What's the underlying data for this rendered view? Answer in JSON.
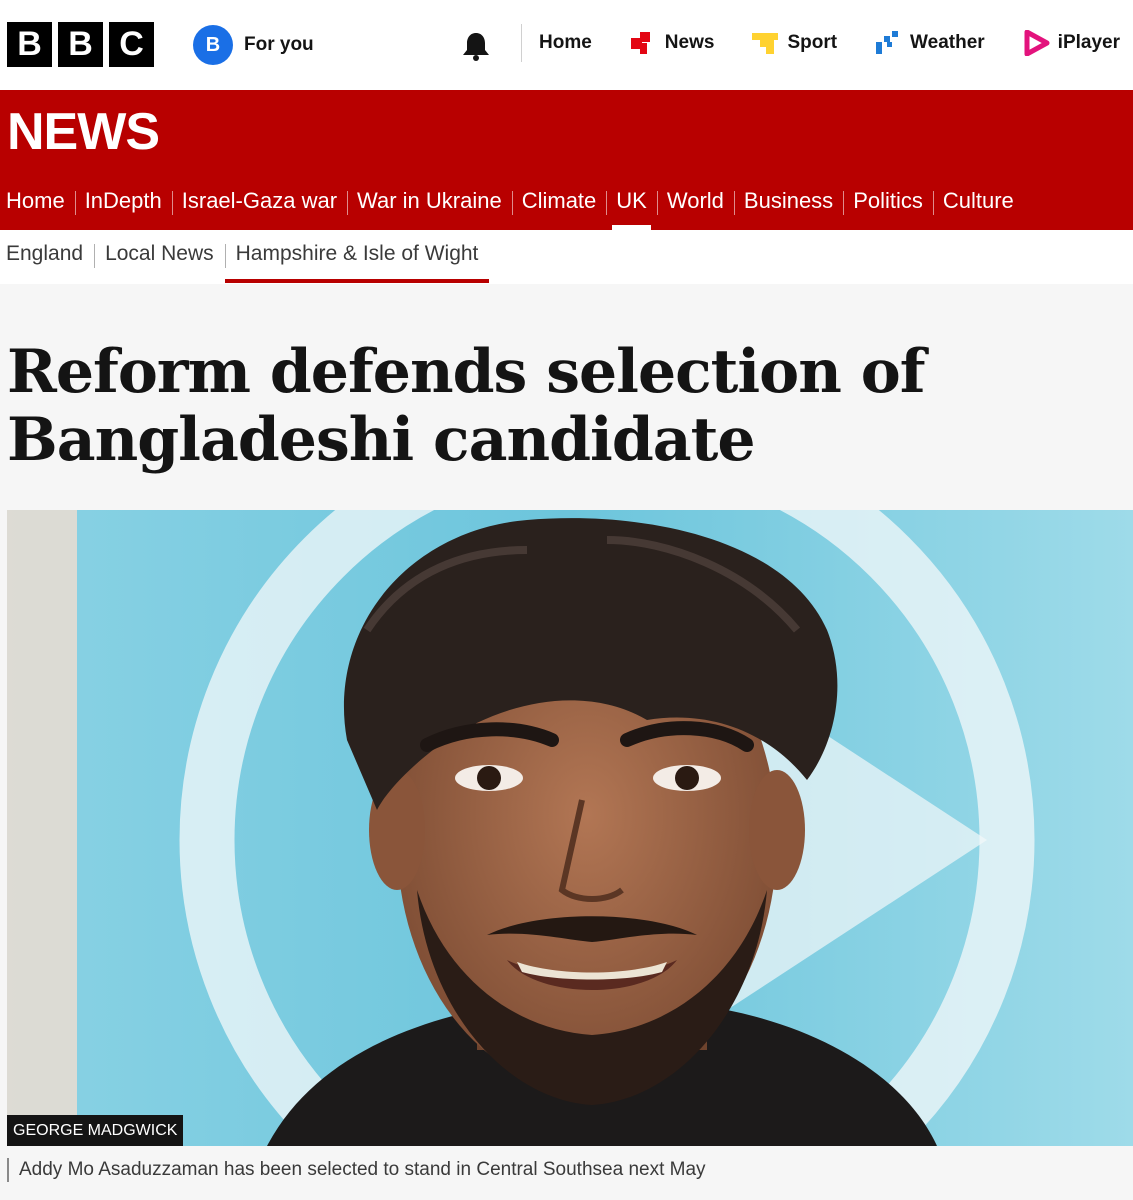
{
  "brand": {
    "letters": [
      "B",
      "B",
      "C"
    ]
  },
  "account": {
    "badge": "B",
    "label": "For you"
  },
  "icons": {
    "notifications": "bell-icon",
    "home": "",
    "news": "news-icon",
    "sport": "sport-icon",
    "weather": "weather-icon",
    "iplayer": "iplayer-icon"
  },
  "topnav": {
    "home": "Home",
    "news": "News",
    "sport": "Sport",
    "weather": "Weather",
    "iplayer": "iPlayer"
  },
  "colors": {
    "news_red": "#b80000",
    "news_icon": "#e30613",
    "sport_icon": "#ffd230",
    "weather_icon": "#1e7bd6",
    "iplayer_icon": "#e3137d",
    "account_blue": "#1a6fe6"
  },
  "section": {
    "wordmark": "NEWS"
  },
  "mainnav": {
    "items": [
      "Home",
      "InDepth",
      "Israel-Gaza war",
      "War in Ukraine",
      "Climate",
      "UK",
      "World",
      "Business",
      "Politics",
      "Culture"
    ],
    "active": "UK"
  },
  "subnav": {
    "items": [
      "England",
      "Local News",
      "Hampshire & Isle of Wight"
    ],
    "active": "Hampshire & Isle of Wight"
  },
  "article": {
    "headline": "Reform defends selection of Bangladeshi candidate",
    "image_credit": "GEORGE MADGWICK",
    "image_caption": "Addy Mo Asaduzzaman has been selected to stand in Central Southsea next May"
  }
}
